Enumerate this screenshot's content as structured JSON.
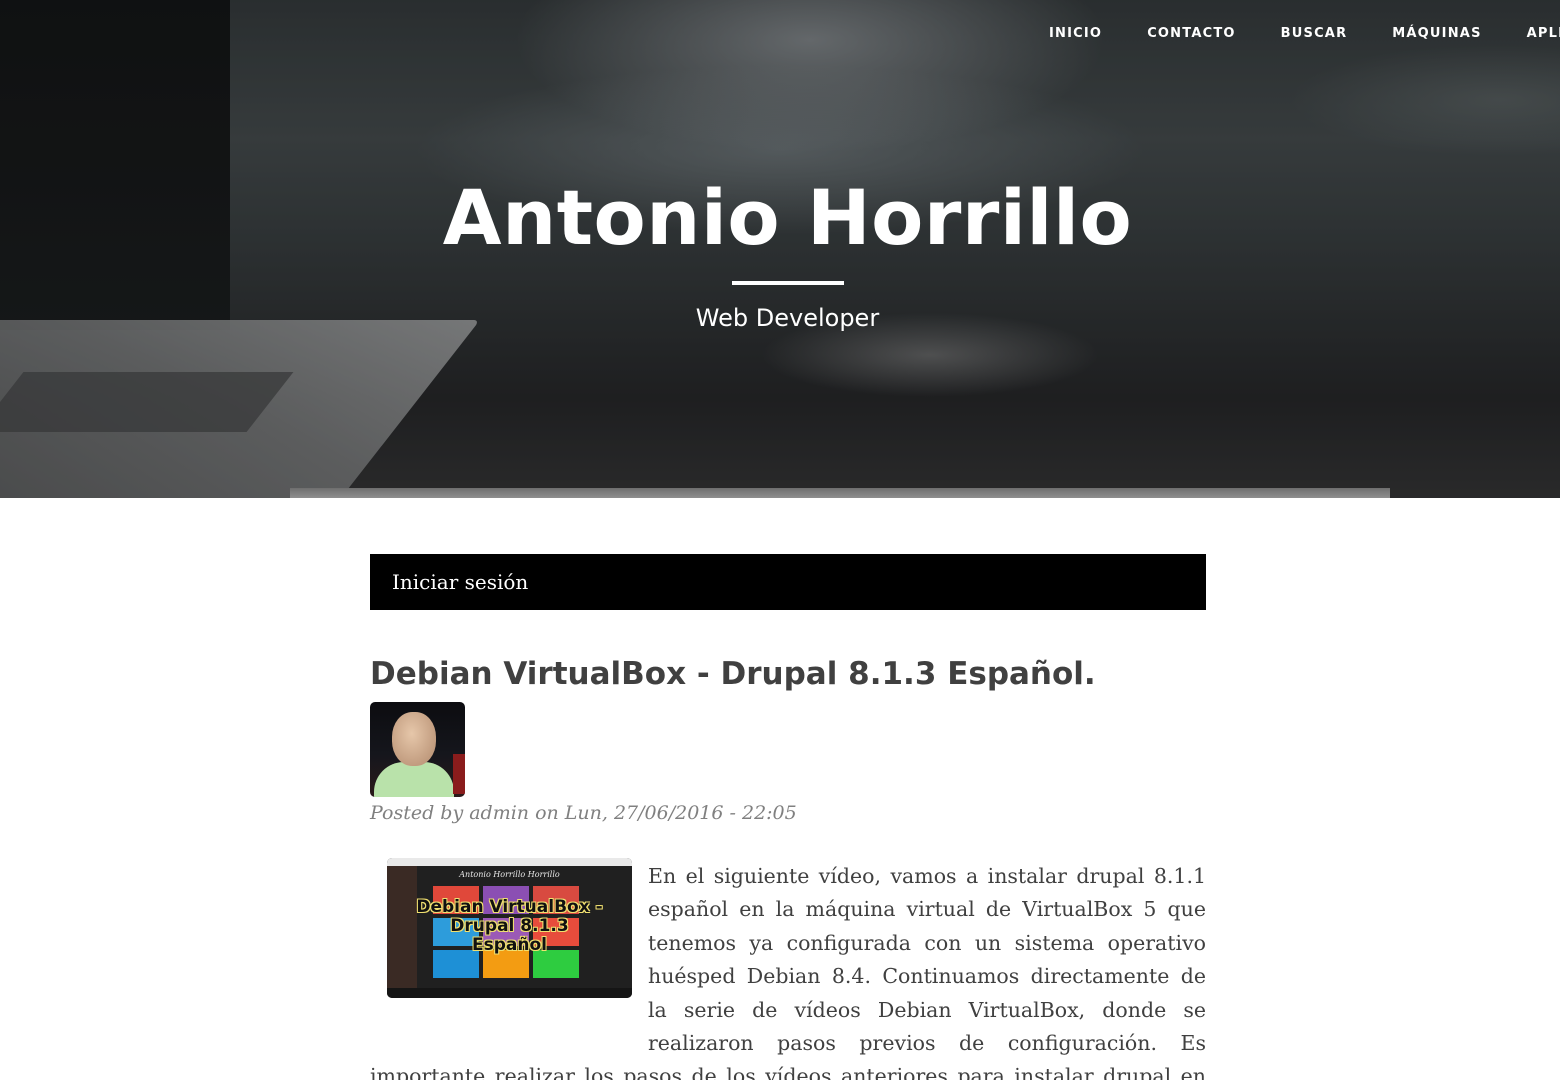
{
  "nav": {
    "items": [
      {
        "label": "INICIO"
      },
      {
        "label": "CONTACTO"
      },
      {
        "label": "BUSCAR"
      },
      {
        "label": "MÁQUINAS"
      },
      {
        "label": "APLICA"
      }
    ]
  },
  "hero": {
    "title": "Antonio Horrillo",
    "subtitle": "Web Developer"
  },
  "login": {
    "label": "Iniciar sesión"
  },
  "post": {
    "title": "Debian VirtualBox - Drupal 8.1.3 Español.",
    "meta": "Posted by admin on Lun, 27/06/2016 - 22:05",
    "thumbnail": {
      "mini_title": "Antonio Horrillo Horrillo",
      "caption_line1": "Debian VirtualBox -",
      "caption_line2": "Drupal 8.1.3",
      "caption_line3": "Español"
    },
    "body": "En el siguiente vídeo, vamos a instalar drupal 8.1.1 español en la máquina virtual de VirtualBox 5 que tenemos ya configurada con un sistema operativo huésped Debian 8.4. Continuamos directamente de la serie de vídeos Debian VirtualBox, donde se realizaron pasos previos de configuración. Es importante realizar los pasos de los vídeos anteriores para instalar drupal en este vídeo."
  },
  "colors": {
    "login_bar": "#000000",
    "text": "#404040",
    "meta": "#808080"
  }
}
